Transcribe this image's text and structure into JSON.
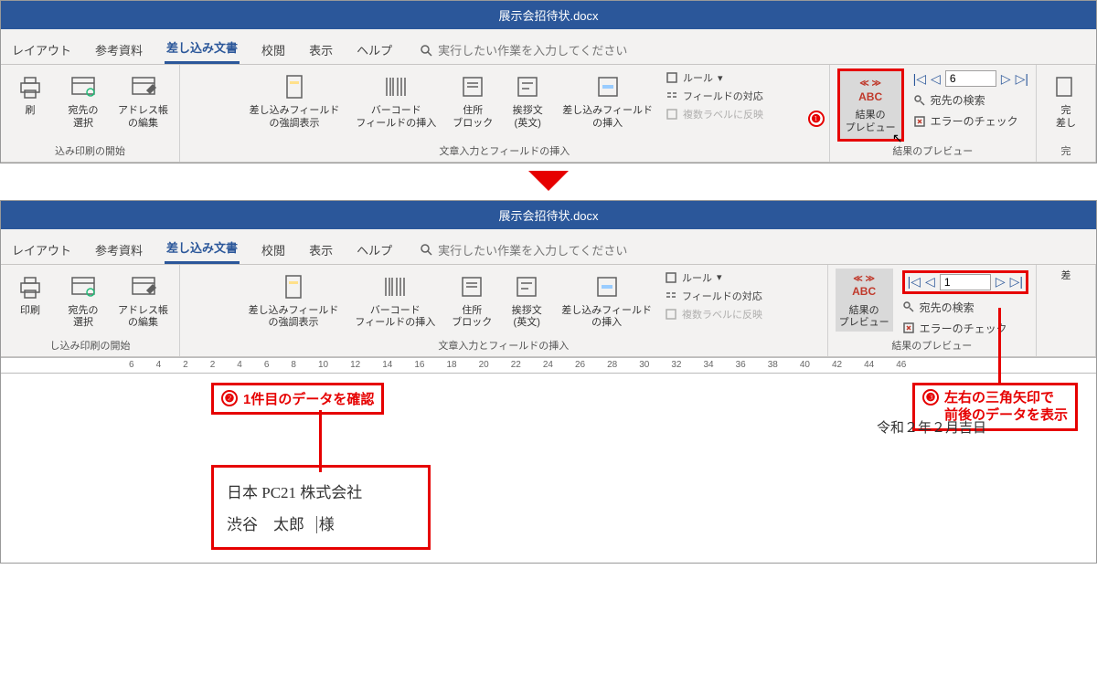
{
  "title": "展示会招待状.docx",
  "tabs": {
    "layout": "レイアウト",
    "references": "参考資料",
    "mailings": "差し込み文書",
    "review": "校閲",
    "view": "表示",
    "help": "ヘルプ",
    "search_placeholder": "実行したい作業を入力してください"
  },
  "groups": {
    "start_mail_merge": "込み印刷の開始",
    "start_mail_merge2": "し込み印刷の開始",
    "write_insert": "文章入力とフィールドの挿入",
    "preview_results": "結果のプレビュー",
    "finish": "完"
  },
  "buttons": {
    "print": "刷",
    "print2": "印刷",
    "select_recipients": "宛先の\n選択",
    "edit_recipients": "アドレス帳\nの編集",
    "highlight_fields": "差し込みフィールド\nの強調表示",
    "barcode": "バーコード\nフィールドの挿入",
    "address_block": "住所\nブロック",
    "greeting_line": "挨拶文\n(英文)",
    "insert_merge_field": "差し込みフィールド\nの挿入",
    "rules": "ルール",
    "match_fields": "フィールドの対応",
    "update_labels": "複数ラベルに反映",
    "preview_results_btn": "結果の\nプレビュー",
    "find_recipient": "宛先の検索",
    "check_errors": "エラーのチェック",
    "finish_merge": "完\n差し",
    "finish_merge2": "差"
  },
  "nav": {
    "record_top": "6",
    "record_bottom": "1"
  },
  "callouts": {
    "c1": "",
    "c2": "1件目のデータを確認",
    "c3_line1": "左右の三角矢印で",
    "c3_line2": "前後のデータを表示"
  },
  "document": {
    "date": "令和２年２月吉日",
    "company": "日本 PC21 株式会社",
    "name": "渋谷　太郎",
    "honorific": "様"
  },
  "ruler_ticks": [
    "6",
    "4",
    "2",
    "2",
    "4",
    "6",
    "8",
    "10",
    "12",
    "14",
    "16",
    "18",
    "20",
    "22",
    "24",
    "26",
    "28",
    "30",
    "32",
    "34",
    "36",
    "38",
    "40",
    "42",
    "44",
    "46"
  ]
}
